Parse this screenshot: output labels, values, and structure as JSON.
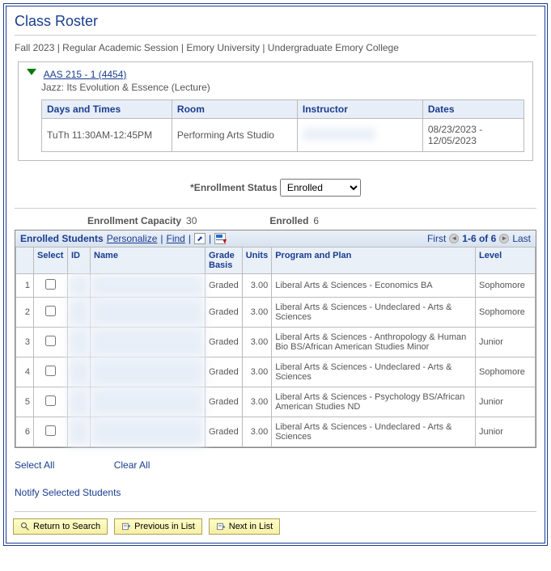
{
  "page": {
    "title": "Class Roster"
  },
  "session": "Fall 2023 | Regular Academic Session | Emory University | Undergraduate Emory College",
  "course": {
    "link": "AAS 215 - 1 (4454)",
    "desc": "Jazz: Its Evolution & Essence (Lecture)",
    "headers": {
      "days": "Days and Times",
      "room": "Room",
      "instructor": "Instructor",
      "dates": "Dates"
    },
    "days_times": "TuTh 11:30AM-12:45PM",
    "room": "Performing Arts Studio",
    "instructor": " ",
    "dates": "08/23/2023 - 12/05/2023"
  },
  "enroll_status": {
    "label": "*Enrollment Status",
    "value": "Enrolled"
  },
  "stats": {
    "capacity_label": "Enrollment Capacity",
    "capacity_value": "30",
    "enrolled_label": "Enrolled",
    "enrolled_value": "6"
  },
  "grid": {
    "title": "Enrolled Students",
    "personalize": "Personalize",
    "find": "Find",
    "first": "First",
    "range": "1-6 of 6",
    "last": "Last",
    "headers": {
      "rownum": " ",
      "select": "Select",
      "id": "ID",
      "name": "Name",
      "grade": "Grade Basis",
      "units": "Units",
      "program": "Program and Plan",
      "level": "Level"
    },
    "rows": [
      {
        "n": "1",
        "grade": "Graded",
        "units": "3.00",
        "program": "Liberal Arts & Sciences - Economics BA",
        "level": "Sophomore"
      },
      {
        "n": "2",
        "grade": "Graded",
        "units": "3.00",
        "program": "Liberal Arts & Sciences - Undeclared - Arts & Sciences",
        "level": "Sophomore"
      },
      {
        "n": "3",
        "grade": "Graded",
        "units": "3.00",
        "program": "Liberal Arts & Sciences - Anthropology & Human Bio BS/African American Studies Minor",
        "level": "Junior"
      },
      {
        "n": "4",
        "grade": "Graded",
        "units": "3.00",
        "program": "Liberal Arts & Sciences - Undeclared - Arts & Sciences",
        "level": "Sophomore"
      },
      {
        "n": "5",
        "grade": "Graded",
        "units": "3.00",
        "program": "Liberal Arts & Sciences - Psychology BS/African American Studies ND",
        "level": "Junior"
      },
      {
        "n": "6",
        "grade": "Graded",
        "units": "3.00",
        "program": "Liberal Arts & Sciences - Undeclared - Arts & Sciences",
        "level": "Junior"
      }
    ]
  },
  "links": {
    "select_all": "Select All",
    "clear_all": "Clear All",
    "notify": "Notify Selected Students"
  },
  "buttons": {
    "return": "Return to Search",
    "prev": "Previous in List",
    "next": "Next in List"
  }
}
